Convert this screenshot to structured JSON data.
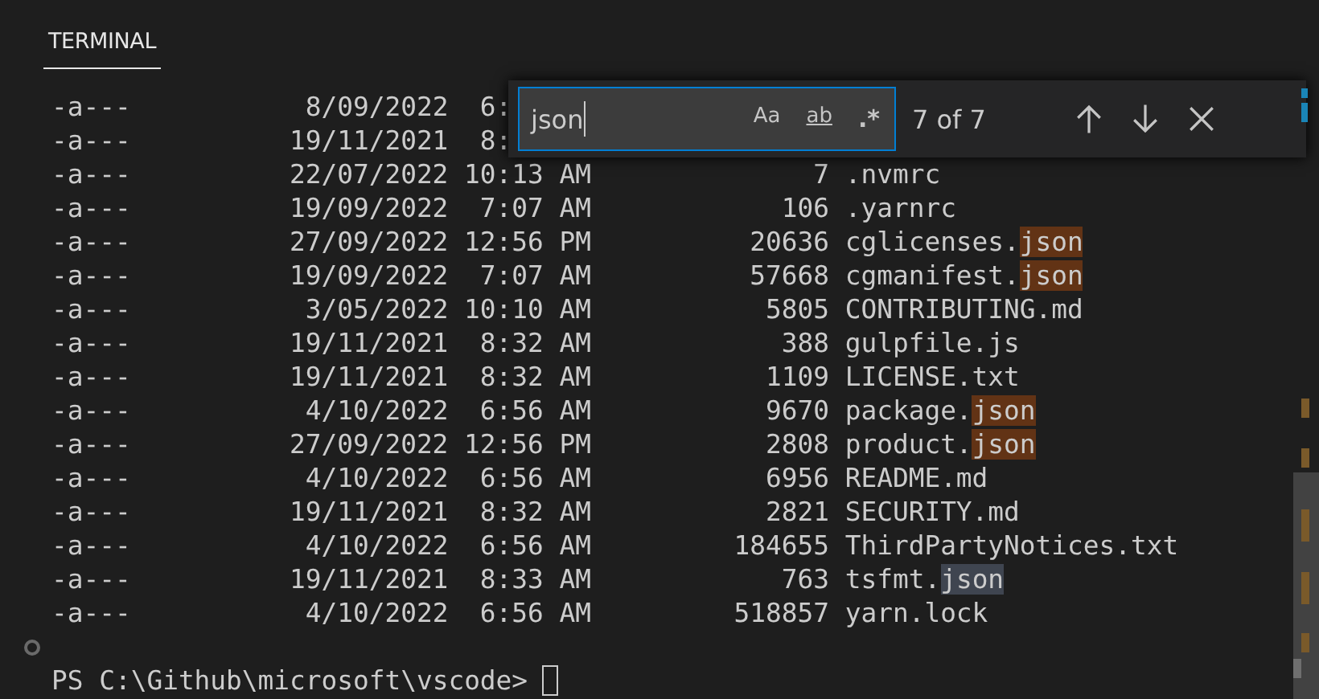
{
  "tabs": [
    {
      "label": "TERMINAL",
      "selected": true
    }
  ],
  "rows": [
    {
      "mode": "-a---",
      "date": "8/09/2022",
      "time": "6:",
      "size": "",
      "name": []
    },
    {
      "mode": "-a---",
      "date": "19/11/2021",
      "time": "8:",
      "size": "",
      "name": []
    },
    {
      "mode": "-a---",
      "date": "22/07/2022",
      "time": "10:13 AM",
      "size": "7",
      "name": [
        {
          "text": ".nvmrc",
          "match": false,
          "selected": false
        }
      ]
    },
    {
      "mode": "-a---",
      "date": "19/09/2022",
      "time": "7:07 AM",
      "size": "106",
      "name": [
        {
          "text": ".yarnrc",
          "match": false,
          "selected": false
        }
      ]
    },
    {
      "mode": "-a---",
      "date": "27/09/2022",
      "time": "12:56 PM",
      "size": "20636",
      "name": [
        {
          "text": "cglicenses.",
          "match": false,
          "selected": false
        },
        {
          "text": "json",
          "match": true,
          "selected": false
        }
      ]
    },
    {
      "mode": "-a---",
      "date": "19/09/2022",
      "time": "7:07 AM",
      "size": "57668",
      "name": [
        {
          "text": "cgmanifest.",
          "match": false,
          "selected": false
        },
        {
          "text": "json",
          "match": true,
          "selected": false
        }
      ]
    },
    {
      "mode": "-a---",
      "date": "3/05/2022",
      "time": "10:10 AM",
      "size": "5805",
      "name": [
        {
          "text": "CONTRIBUTING.md",
          "match": false,
          "selected": false
        }
      ]
    },
    {
      "mode": "-a---",
      "date": "19/11/2021",
      "time": "8:32 AM",
      "size": "388",
      "name": [
        {
          "text": "gulpfile.js",
          "match": false,
          "selected": false
        }
      ]
    },
    {
      "mode": "-a---",
      "date": "19/11/2021",
      "time": "8:32 AM",
      "size": "1109",
      "name": [
        {
          "text": "LICENSE.txt",
          "match": false,
          "selected": false
        }
      ]
    },
    {
      "mode": "-a---",
      "date": "4/10/2022",
      "time": "6:56 AM",
      "size": "9670",
      "name": [
        {
          "text": "package.",
          "match": false,
          "selected": false
        },
        {
          "text": "json",
          "match": true,
          "selected": false
        }
      ]
    },
    {
      "mode": "-a---",
      "date": "27/09/2022",
      "time": "12:56 PM",
      "size": "2808",
      "name": [
        {
          "text": "product.",
          "match": false,
          "selected": false
        },
        {
          "text": "json",
          "match": true,
          "selected": false
        }
      ]
    },
    {
      "mode": "-a---",
      "date": "4/10/2022",
      "time": "6:56 AM",
      "size": "6956",
      "name": [
        {
          "text": "README.md",
          "match": false,
          "selected": false
        }
      ]
    },
    {
      "mode": "-a---",
      "date": "19/11/2021",
      "time": "8:32 AM",
      "size": "2821",
      "name": [
        {
          "text": "SECURITY.md",
          "match": false,
          "selected": false
        }
      ]
    },
    {
      "mode": "-a---",
      "date": "4/10/2022",
      "time": "6:56 AM",
      "size": "184655",
      "name": [
        {
          "text": "ThirdPartyNotices.txt",
          "match": false,
          "selected": false
        }
      ]
    },
    {
      "mode": "-a---",
      "date": "19/11/2021",
      "time": "8:33 AM",
      "size": "763",
      "name": [
        {
          "text": "tsfmt.",
          "match": false,
          "selected": false
        },
        {
          "text": "json",
          "match": true,
          "selected": true
        }
      ]
    },
    {
      "mode": "-a---",
      "date": "4/10/2022",
      "time": "6:56 AM",
      "size": "518857",
      "name": [
        {
          "text": "yarn.lock",
          "match": false,
          "selected": false
        }
      ]
    }
  ],
  "prompt": "PS C:\\Github\\microsoft\\vscode>",
  "find": {
    "value": "json",
    "options": [
      {
        "label": "Aa",
        "kind": "case",
        "on": false
      },
      {
        "label": "ab",
        "kind": "word",
        "on": false
      },
      {
        "label": ".*",
        "kind": "regex",
        "on": false
      }
    ],
    "result": "7 of 7"
  }
}
